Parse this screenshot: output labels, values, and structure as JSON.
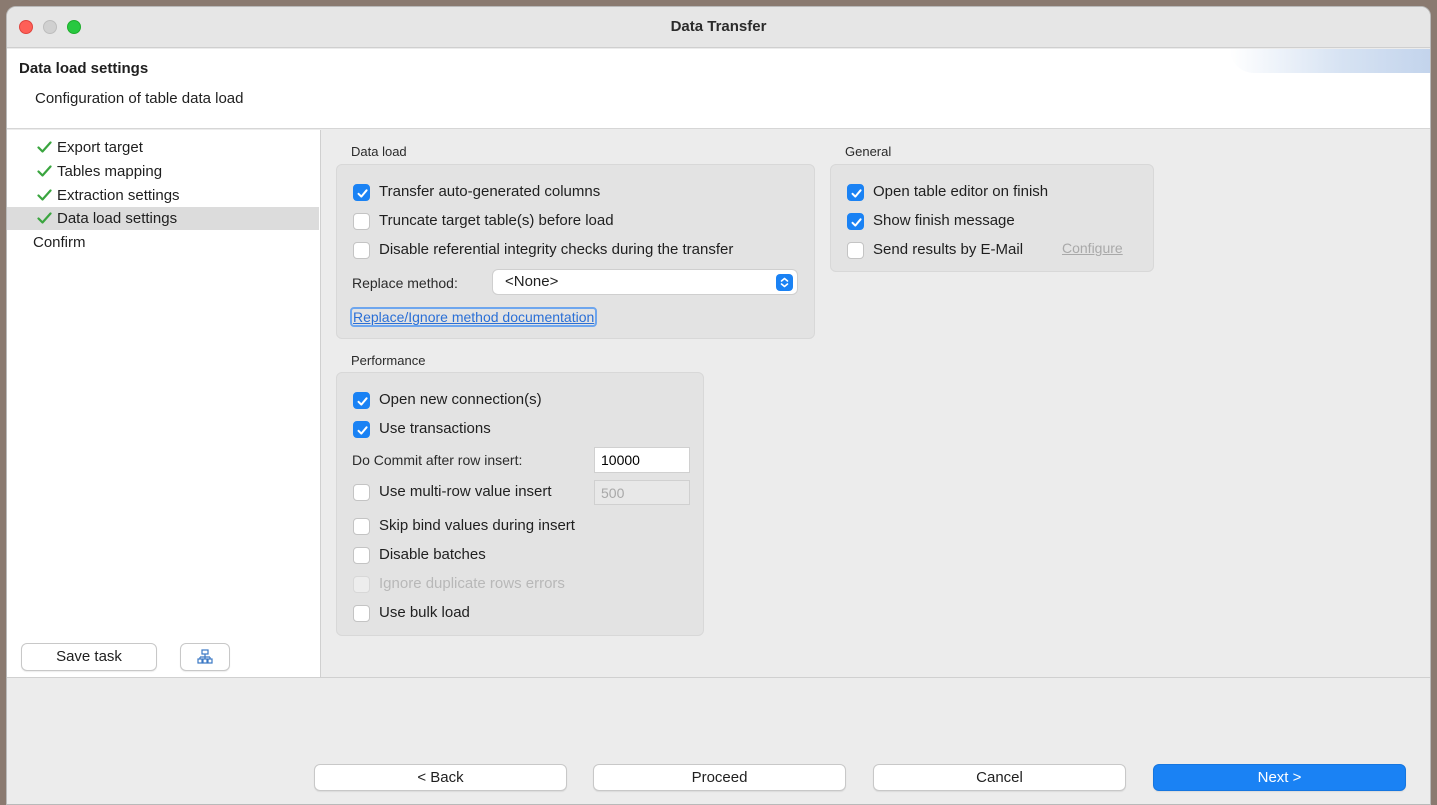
{
  "window": {
    "title": "Data Transfer"
  },
  "header": {
    "title": "Data load settings",
    "description": "Configuration of table data load"
  },
  "sidebar": {
    "items": [
      {
        "label": "Export target",
        "done": true
      },
      {
        "label": "Tables mapping",
        "done": true
      },
      {
        "label": "Extraction settings",
        "done": true
      },
      {
        "label": "Data load settings",
        "done": true,
        "selected": true
      },
      {
        "label": "Confirm",
        "done": false
      }
    ],
    "save_task_label": "Save task",
    "task_icon": "task-hierarchy-icon"
  },
  "data_load": {
    "title": "Data load",
    "transfer_auto_generated": {
      "label": "Transfer auto-generated columns",
      "checked": true
    },
    "truncate_target": {
      "label": "Truncate target table(s) before load",
      "checked": false
    },
    "disable_referential": {
      "label": "Disable referential integrity checks during the transfer",
      "checked": false
    },
    "replace_method_label": "Replace method:",
    "replace_method_value": "<None>",
    "doc_link": "Replace/Ignore method documentation"
  },
  "general": {
    "title": "General",
    "open_table_editor": {
      "label": "Open table editor on finish",
      "checked": true
    },
    "show_finish_message": {
      "label": "Show finish message",
      "checked": true
    },
    "send_results_email": {
      "label": "Send results by E-Mail",
      "checked": false
    },
    "configure_link": "Configure"
  },
  "performance": {
    "title": "Performance",
    "open_new_connections": {
      "label": "Open new connection(s)",
      "checked": true
    },
    "use_transactions": {
      "label": "Use transactions",
      "checked": true
    },
    "commit_label": "Do Commit after row insert:",
    "commit_value": "10000",
    "multi_row_insert": {
      "label": "Use multi-row value insert",
      "checked": false
    },
    "multi_row_value": "500",
    "skip_bind_values": {
      "label": "Skip bind values during insert",
      "checked": false
    },
    "disable_batches": {
      "label": "Disable batches",
      "checked": false
    },
    "ignore_duplicate_rows": {
      "label": "Ignore duplicate rows errors",
      "checked": false,
      "disabled": true
    },
    "use_bulk_load": {
      "label": "Use bulk load",
      "checked": false
    }
  },
  "footer": {
    "back_label": "< Back",
    "proceed_label": "Proceed",
    "cancel_label": "Cancel",
    "next_label": "Next >"
  },
  "colors": {
    "accent": "#1a82f4",
    "check_green": "#3aa53f",
    "close_red": "#fe5f57",
    "max_green": "#28c840"
  }
}
